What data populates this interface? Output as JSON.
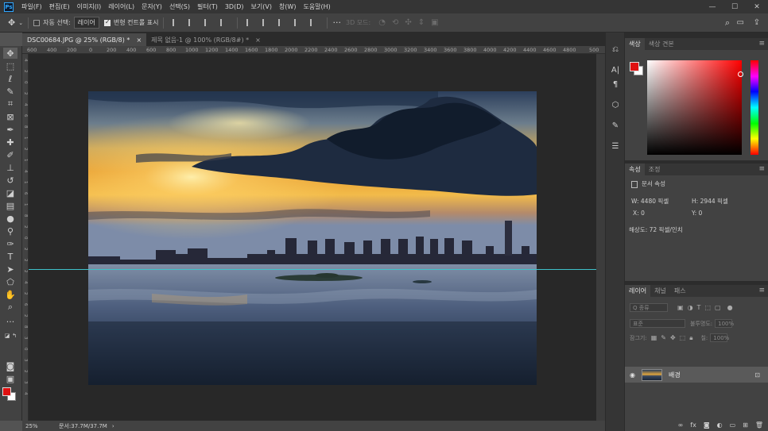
{
  "app": {
    "logo": "Ps"
  },
  "menu": [
    "파일(F)",
    "편집(E)",
    "이미지(I)",
    "레이어(L)",
    "문자(Y)",
    "선택(S)",
    "필터(T)",
    "3D(D)",
    "보기(V)",
    "창(W)",
    "도움말(H)"
  ],
  "window_controls": {
    "minimize": "—",
    "maximize": "☐",
    "close": "✕"
  },
  "options": {
    "auto_select_label": "자동 선택:",
    "auto_select_target": "레이어",
    "transform_controls_label": "변형 컨트롤 표시",
    "mode_3d_label": "3D 모드:",
    "more": "···"
  },
  "tabs": [
    {
      "label": "DSC00684.JPG @ 25% (RGB/8) *",
      "close": "×"
    },
    {
      "label": "제목 없음-1 @ 100% (RGB/8#) *",
      "close": "×"
    }
  ],
  "ruler": {
    "top": [
      "600",
      "400",
      "200",
      "0",
      "200",
      "400",
      "600",
      "800",
      "1000",
      "1200",
      "1400",
      "1600",
      "1800",
      "2000",
      "2200",
      "2400",
      "2600",
      "2800",
      "3000",
      "3200",
      "3400",
      "3600",
      "3800",
      "4000",
      "4200",
      "4400",
      "4600",
      "4800",
      "500"
    ],
    "left": [
      "4",
      "2",
      "0",
      "2",
      "4",
      "6",
      "8",
      "1",
      "2",
      "1",
      "4",
      "1",
      "6",
      "1",
      "8",
      "2",
      "0",
      "2",
      "2",
      "2",
      "4",
      "2",
      "6",
      "2",
      "8",
      "3",
      "0",
      "3",
      "2",
      "3",
      "4"
    ]
  },
  "status": {
    "zoom": "25%",
    "doc_size": "문서:37.7M/37.7M",
    "arrow": "›"
  },
  "color_panel": {
    "tabs": [
      "색상",
      "색상 견본"
    ]
  },
  "properties_panel": {
    "tabs": [
      "속성",
      "조정"
    ],
    "section": "문서 속성",
    "width_label": "W:",
    "width": "4480 픽셀",
    "height_label": "H:",
    "height": "2944 픽셀",
    "x_label": "X:",
    "x": "0",
    "y_label": "Y:",
    "y": "0",
    "resolution": "해상도: 72 픽셀/인치"
  },
  "layers_panel": {
    "tabs": [
      "레이어",
      "채널",
      "패스"
    ],
    "filter_placeholder": "Q 종류",
    "blend_mode": "표준",
    "opacity_label": "불투명도:",
    "opacity": "100%",
    "lock_label": "잠그기:",
    "fill_label": "칠:",
    "fill": "100%",
    "layers": [
      {
        "name": "배경"
      }
    ]
  },
  "colors": {
    "foreground": "#e01111",
    "background": "#ffffff",
    "guide": "#3fc1c9",
    "accent": "#31a8ff"
  }
}
